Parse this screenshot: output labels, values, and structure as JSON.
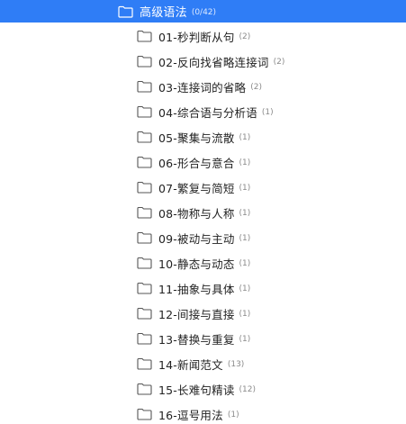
{
  "parent": {
    "label": "高级语法",
    "count": "(0/42)"
  },
  "items": [
    {
      "label": "01-秒判断从句",
      "count": "(2)"
    },
    {
      "label": "02-反向找省略连接词",
      "count": "(2)"
    },
    {
      "label": "03-连接词的省略",
      "count": "(2)"
    },
    {
      "label": "04-综合语与分析语",
      "count": "(1)"
    },
    {
      "label": "05-聚集与流散",
      "count": "(1)"
    },
    {
      "label": "06-形合与意合",
      "count": "(1)"
    },
    {
      "label": "07-繁复与简短",
      "count": "(1)"
    },
    {
      "label": "08-物称与人称",
      "count": "(1)"
    },
    {
      "label": "09-被动与主动",
      "count": "(1)"
    },
    {
      "label": "10-静态与动态",
      "count": "(1)"
    },
    {
      "label": "11-抽象与具体",
      "count": "(1)"
    },
    {
      "label": "12-间接与直接",
      "count": "(1)"
    },
    {
      "label": "13-替换与重复",
      "count": "(1)"
    },
    {
      "label": "14-新闻范文",
      "count": "(13)"
    },
    {
      "label": "15-长难句精读",
      "count": "(12)"
    },
    {
      "label": "16-逗号用法",
      "count": "(1)"
    }
  ],
  "colors": {
    "selection": "#2f7df6",
    "folder_stroke": "#555555"
  },
  "icons": {
    "folder": "folder-icon"
  }
}
